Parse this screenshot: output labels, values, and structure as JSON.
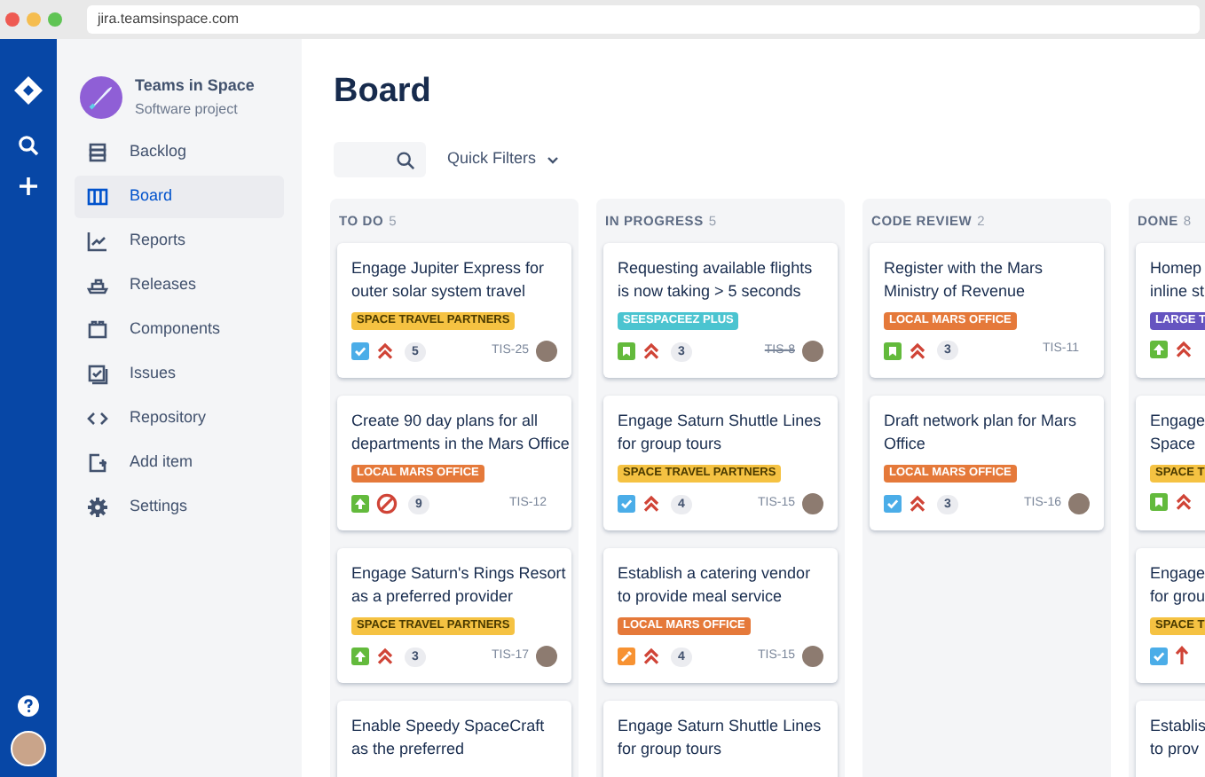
{
  "browser": {
    "url": "jira.teamsinspace.com"
  },
  "project": {
    "name": "Teams in Space",
    "type": "Software project"
  },
  "nav": [
    {
      "label": "Backlog",
      "selected": false
    },
    {
      "label": "Board",
      "selected": true
    },
    {
      "label": "Reports",
      "selected": false
    },
    {
      "label": "Releases",
      "selected": false
    },
    {
      "label": "Components",
      "selected": false
    },
    {
      "label": "Issues",
      "selected": false
    },
    {
      "label": "Repository",
      "selected": false
    },
    {
      "label": "Add item",
      "selected": false
    },
    {
      "label": "Settings",
      "selected": false
    }
  ],
  "board": {
    "title": "Board",
    "quick_filters": "Quick Filters"
  },
  "columns": [
    {
      "title": "TO DO",
      "count": "5",
      "cards": [
        {
          "lines": [
            "Engage Jupiter Express for",
            "outer solar system travel"
          ],
          "tag": {
            "text": "SPACE TRAVEL PARTNERS",
            "color": "#f5c242"
          },
          "kind": "task",
          "priority": {
            "kind": "highest"
          },
          "points": "5",
          "key": "TIS-25",
          "resolved": false,
          "avatar": true
        },
        {
          "lines": [
            "Create 90 day plans for all",
            "departments in the Mars Office"
          ],
          "tag": {
            "text": "LOCAL MARS OFFICE",
            "color": "#e5793a"
          },
          "kind": "improvement",
          "priority": {
            "kind": "blocker"
          },
          "points": "9",
          "key": "TIS-12",
          "resolved": false,
          "avatar": false
        },
        {
          "lines": [
            "Engage Saturn's Rings Resort",
            "as a preferred provider"
          ],
          "tag": {
            "text": "SPACE TRAVEL PARTNERS",
            "color": "#f5c242"
          },
          "kind": "improvement",
          "priority": {
            "kind": "highest"
          },
          "points": "3",
          "key": "TIS-17",
          "resolved": false,
          "avatar": true
        },
        {
          "lines": [
            "Enable Speedy SpaceCraft",
            "as the preferred"
          ]
        }
      ]
    },
    {
      "title": "IN PROGRESS",
      "count": "5",
      "cards": [
        {
          "lines": [
            "Requesting available flights",
            "is now taking > 5 seconds"
          ],
          "tag": {
            "text": "SEESPACEEZ PLUS",
            "color": "#4bc4d0"
          },
          "kind": "story",
          "priority": {
            "kind": "highest"
          },
          "points": "3",
          "key": "TIS-8",
          "resolved": true,
          "avatar": true
        },
        {
          "lines": [
            "Engage Saturn Shuttle Lines",
            "for group tours"
          ],
          "tag": {
            "text": "SPACE TRAVEL PARTNERS",
            "color": "#f5c242"
          },
          "kind": "task",
          "priority": {
            "kind": "highest"
          },
          "points": "4",
          "key": "TIS-15",
          "resolved": false,
          "avatar": true
        },
        {
          "lines": [
            "Establish a catering vendor",
            "to provide meal service"
          ],
          "tag": {
            "text": "LOCAL MARS OFFICE",
            "color": "#e5793a"
          },
          "kind": "subtask",
          "priority": {
            "kind": "highest"
          },
          "points": "4",
          "key": "TIS-15",
          "resolved": false,
          "avatar": true
        },
        {
          "lines": [
            "Engage Saturn Shuttle Lines",
            "for group tours"
          ]
        }
      ]
    },
    {
      "title": "CODE REVIEW",
      "count": "2",
      "cards": [
        {
          "lines": [
            "Register with the Mars",
            "Ministry of Revenue"
          ],
          "tag": {
            "text": "LOCAL MARS OFFICE",
            "color": "#e5793a"
          },
          "kind": "story",
          "priority": {
            "kind": "highest"
          },
          "points": "3",
          "key": "TIS-11",
          "resolved": false,
          "avatar": false
        },
        {
          "lines": [
            "Draft network plan for Mars",
            "Office"
          ],
          "tag": {
            "text": "LOCAL MARS OFFICE",
            "color": "#e5793a"
          },
          "kind": "task",
          "priority": {
            "kind": "highest"
          },
          "points": "3",
          "key": "TIS-16",
          "resolved": false,
          "avatar": true
        }
      ]
    },
    {
      "title": "DONE",
      "count": "8",
      "cards": [
        {
          "lines": [
            "Homep",
            "inline st"
          ],
          "tag": {
            "text": "LARGE T",
            "color": "#6554c0"
          },
          "kind": "improvement",
          "priority": {
            "kind": "highest"
          }
        },
        {
          "lines": [
            "Engage",
            "Space"
          ],
          "tag": {
            "text": "SPACE T",
            "color": "#f5c242"
          },
          "kind": "story",
          "priority": {
            "kind": "highest"
          }
        },
        {
          "lines": [
            "Engage",
            "for grou"
          ],
          "tag": {
            "text": "SPACE T",
            "color": "#f5c242"
          },
          "kind": "task",
          "priority": {
            "kind": "high"
          }
        },
        {
          "lines": [
            "Establis",
            "to prov"
          ]
        }
      ]
    }
  ]
}
